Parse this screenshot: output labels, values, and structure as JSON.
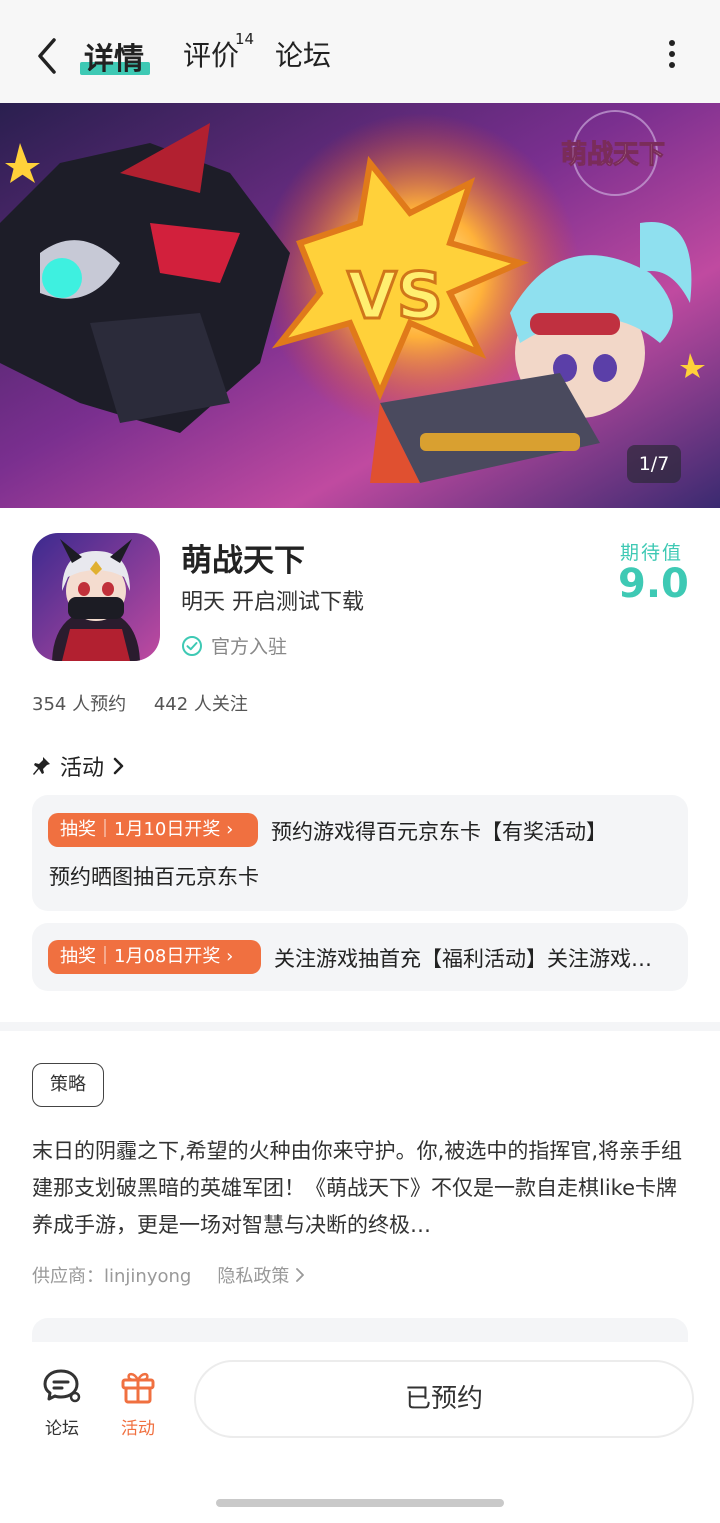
{
  "header": {
    "tabs": [
      {
        "label": "详情",
        "active": true
      },
      {
        "label": "评价",
        "count": "14"
      },
      {
        "label": "论坛"
      }
    ],
    "accent_color": "#3ec9b4"
  },
  "banner": {
    "counter": "1/7",
    "logo_text": "萌战天下",
    "vs_text": "VS"
  },
  "app": {
    "name": "萌战天下",
    "status": "明天 开启测试下载",
    "verified_label": "官方入驻",
    "score_label": "期待值",
    "score": "9.0",
    "reservations": "354 人预约",
    "followers": "442 人关注"
  },
  "activity": {
    "header": "活动",
    "items": [
      {
        "badge": "抽奖｜1月10日开奖 ›",
        "title": "预约游戏得百元京东卡【有奖活动】",
        "desc": "预约晒图抽百元京东卡"
      },
      {
        "badge": "抽奖｜1月08日开奖 ›",
        "title": "关注游戏抽首充【福利活动】关注游戏抽首充"
      }
    ],
    "badge_color": "#f07040"
  },
  "description": {
    "tag": "策略",
    "text": "末日的阴霾之下,希望的火种由你来守护。你,被选中的指挥官,将亲手组建那支划破黑暗的英雄军团！《萌战天下》不仅是一款自走棋like卡牌养成手游，更是一场对智慧与决断的终极…",
    "supplier": "供应商：linjinyong",
    "privacy": "隐私政策"
  },
  "bottom_bar": {
    "forum_label": "论坛",
    "activity_label": "活动",
    "reserved_label": "已预约"
  }
}
